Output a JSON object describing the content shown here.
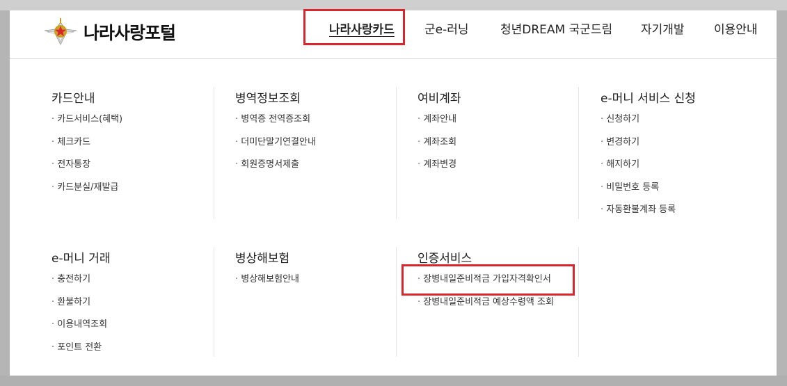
{
  "header": {
    "logo_text": "나라사랑포털",
    "nav": [
      {
        "label": "나라사랑카드",
        "active": true
      },
      {
        "label": "군e-러닝",
        "active": false
      },
      {
        "label": "청년DREAM 국군드림",
        "active": false
      },
      {
        "label": "자기개발",
        "active": false
      },
      {
        "label": "이용안내",
        "active": false
      }
    ]
  },
  "menu": {
    "row1": [
      {
        "title": "카드안내",
        "items": [
          "카드서비스(혜택)",
          "체크카드",
          "전자통장",
          "카드분실/재발급"
        ]
      },
      {
        "title": "병역정보조회",
        "items": [
          "병역증 전역증조회",
          "더미단말기연결안내",
          "회원증명서제출"
        ]
      },
      {
        "title": "여비계좌",
        "items": [
          "계좌안내",
          "계좌조회",
          "계좌변경"
        ]
      },
      {
        "title": "e-머니 서비스 신청",
        "items": [
          "신청하기",
          "변경하기",
          "해지하기",
          "비밀번호 등록",
          "자동환불계좌 등록"
        ]
      }
    ],
    "row2": [
      {
        "title": "e-머니 거래",
        "items": [
          "충전하기",
          "환불하기",
          "이용내역조회",
          "포인트 전환"
        ]
      },
      {
        "title": "병상해보험",
        "items": [
          "병상해보험안내"
        ]
      },
      {
        "title": "인증서비스",
        "items": [
          "장병내일준비적금 가입자격확인서",
          "장병내일준비적금 예상수령액 조회"
        ]
      }
    ]
  },
  "colors": {
    "highlight": "#d9262c",
    "logo_star": "#d9262c",
    "logo_gold": "#c9a227"
  }
}
